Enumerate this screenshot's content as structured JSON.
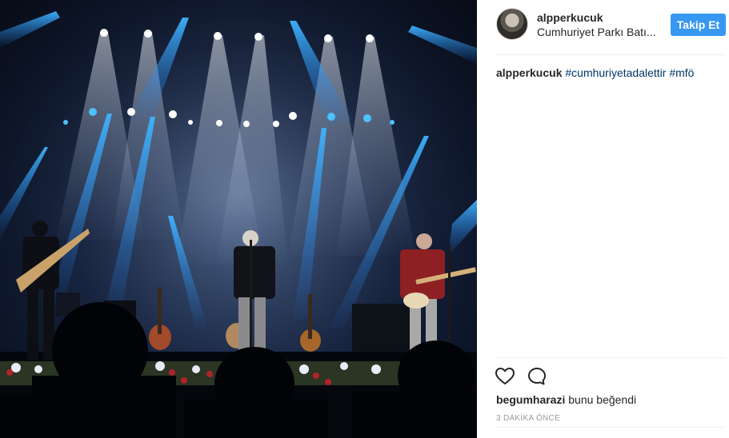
{
  "post": {
    "username": "alpperkucuk",
    "location": "Cumhuriyet Parkı Batı...",
    "follow_label": "Takip Et",
    "caption": {
      "user": "alpperkucuk",
      "tags": [
        "#cumhuriyetadalettir",
        "#mfö"
      ]
    },
    "likes": {
      "liker": "begumharazi",
      "text": "bunu beğendi"
    },
    "timestamp": "3 DAKİKA ÖNCE"
  },
  "icons": {
    "like": "heart-icon",
    "comment": "speech-bubble-icon"
  },
  "colors": {
    "follow_button": "#3897f0",
    "hashtag": "#003569",
    "stage_light": "#39a8ff"
  }
}
